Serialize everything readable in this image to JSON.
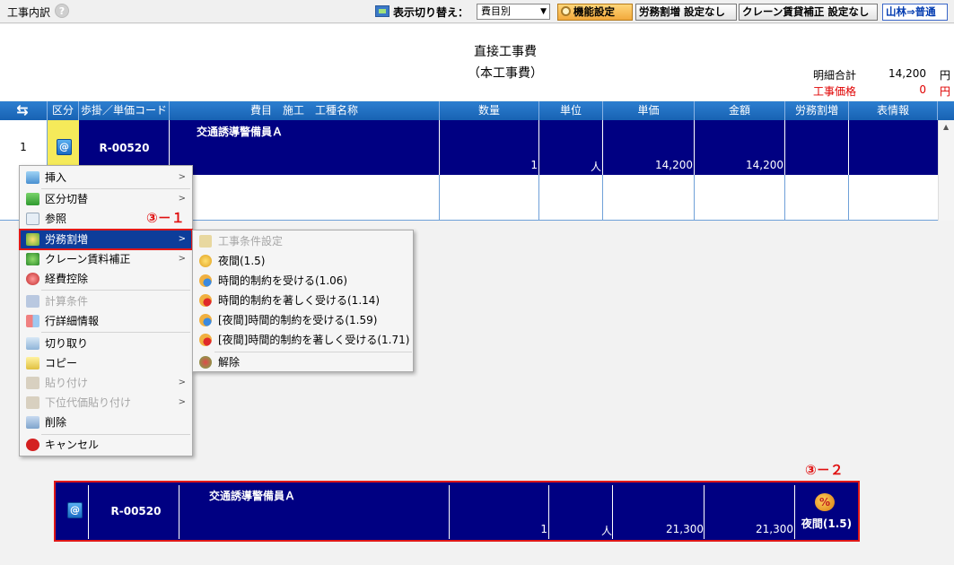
{
  "toolbar": {
    "title": "工事内訳",
    "help": "?",
    "switch_label": "表示切り替え：",
    "view_value": "費目別",
    "func_button": "機能設定",
    "labor_button": "労務割増 設定なし",
    "crane_button": "クレーン賃貸補正 設定なし",
    "forest_button": "山林⇒普通"
  },
  "header": {
    "title1": "直接工事費",
    "title2": "（本工事費）",
    "sum_label": "明細合計",
    "sum_value": "14,200",
    "sum_unit": "円",
    "cost_label": "工事価格",
    "cost_value": "0",
    "cost_unit": "円"
  },
  "columns": {
    "kubun": "区分",
    "code": "歩掛／単価コード",
    "name": "費目　施工　工種名称",
    "qty": "数量",
    "unit": "単位",
    "price": "単価",
    "amount": "金額",
    "labor": "労務割増",
    "info": "表情報"
  },
  "row1": {
    "num": "1",
    "code": "R-00520",
    "name": "交通誘導警備員Ａ",
    "qty": "1",
    "unit": "人",
    "price": "14,200",
    "amount": "14,200"
  },
  "menu": {
    "insert": "挿入",
    "switch": "区分切替",
    "ref": "参照",
    "labor": "労務割増",
    "crane": "クレーン賃料補正",
    "expense": "経費控除",
    "calc": "計算条件",
    "detail": "行詳細情報",
    "cut": "切り取り",
    "copy": "コピー",
    "paste": "貼り付け",
    "lower_paste": "下位代価貼り付け",
    "delete": "削除",
    "cancel": "キャンセル",
    "arrow": ">"
  },
  "submenu": {
    "condition": "工事条件設定",
    "night": "夜間(1.5)",
    "limited": "時間的制約を受ける(1.06)",
    "very_limited": "時間的制約を著しく受ける(1.14)",
    "night_limited": "[夜間]時間的制約を受ける(1.59)",
    "night_very_limited": "[夜間]時間的制約を著しく受ける(1.71)",
    "release": "解除"
  },
  "annotations": {
    "a1": "③－１",
    "a2": "③－２"
  },
  "result_row": {
    "code": "R-00520",
    "name": "交通誘導警備員Ａ",
    "qty": "1",
    "unit": "人",
    "price": "21,300",
    "amount": "21,300",
    "labor_tag": "夜間(1.5)",
    "labor_icon": "%"
  },
  "icons": {
    "at": "@",
    "swap": "⇆",
    "up": "▲",
    "down": "▼"
  },
  "colors": {
    "selected_row": "#000082",
    "header": "#1862b3",
    "annotation": "#e01010"
  }
}
